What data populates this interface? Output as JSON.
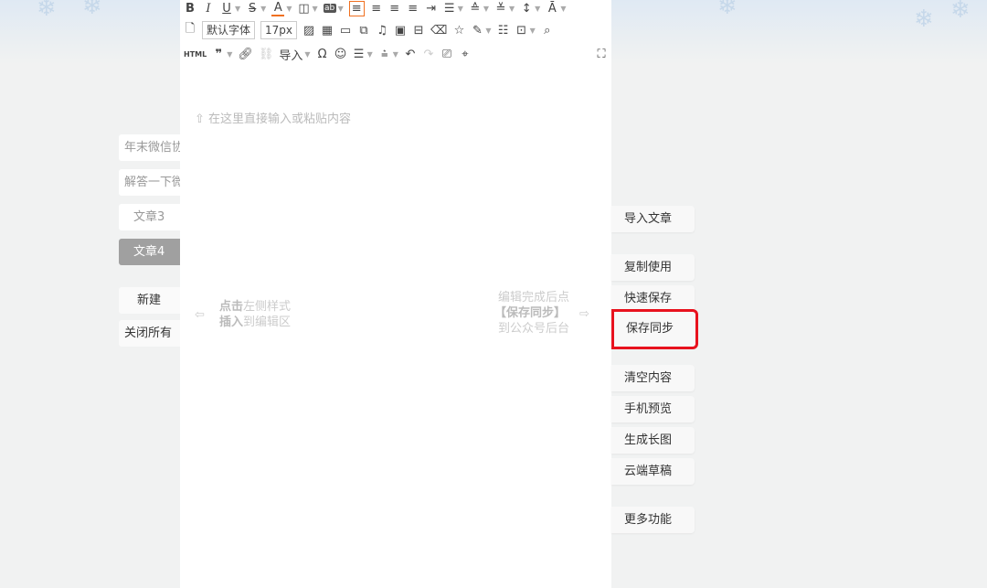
{
  "tabs": [
    {
      "label": "年末微信协"
    },
    {
      "label": "解答一下微"
    },
    {
      "label": "文章3"
    },
    {
      "label": "文章4",
      "active": true
    }
  ],
  "actions": {
    "new": "新建",
    "close_all": "关闭所有"
  },
  "toolbar": {
    "font_family": "默认字体",
    "font_size": "17px",
    "html": "HTML",
    "import": "导入",
    "accent_color": "#f07020"
  },
  "editor": {
    "placeholder": "在这里直接输入或粘贴内容",
    "left_hint": {
      "bold1": "点击",
      "text1": "左侧样式",
      "bold2": "插入",
      "text2": "到编辑区"
    },
    "right_hint": {
      "line1": "编辑完成后点",
      "line2": "【保存同步】",
      "line3": "到公众号后台"
    }
  },
  "side_buttons": [
    {
      "label": "导入文章"
    },
    {
      "label": "复制使用"
    },
    {
      "label": "快速保存"
    },
    {
      "label": "保存同步",
      "highlighted": true
    },
    {
      "label": "清空内容"
    },
    {
      "label": "手机预览"
    },
    {
      "label": "生成长图"
    },
    {
      "label": "云端草稿"
    },
    {
      "label": "更多功能"
    }
  ],
  "highlight_color": "#e8121e"
}
